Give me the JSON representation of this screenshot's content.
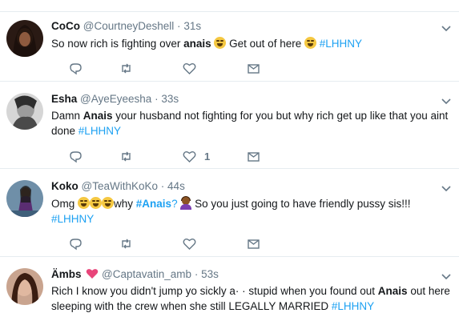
{
  "tweets": [
    {
      "name": "CoCo",
      "handle": "@CourtneyDeshell",
      "dot": "·",
      "time": "31s",
      "text_a": "So now rich is fighting over ",
      "text_b": "anais",
      "text_c": " Get out of here ",
      "text_d": "#LHHNY",
      "likes": ""
    },
    {
      "name": "Esha",
      "handle": "@AyeEyeesha",
      "dot": "·",
      "time": "33s",
      "text_a": "Damn ",
      "text_b": "Anais",
      "text_c": " your husband not fighting for you but why rich get up like that you aint done ",
      "text_d": "#LHHNY",
      "likes": "1"
    },
    {
      "name": "Koko",
      "handle": "@TeaWithKoKo",
      "dot": "·",
      "time": "44s",
      "text_a": "Omg ",
      "text_b": "why ",
      "text_c": "#Anais",
      "text_d": "?",
      "text_e": " So you just going to have friendly pussy sis!!! ",
      "text_f": "#LHHNY",
      "likes": ""
    },
    {
      "name": "Ämbs",
      "handle": "@Captavatin_amb",
      "dot": "·",
      "time": "53s",
      "text_a": "Rich I know you didn't jump yo sickly a· · stupid when you found out ",
      "text_b": "Anais",
      "text_c": " out here sleeping with the crew when she still LEGALLY MARRIED ",
      "text_d": "#LHHNY",
      "likes": ""
    }
  ],
  "colors": {
    "link": "#1da1f2",
    "muted": "#657786",
    "border": "#e6ecf0"
  },
  "icons": [
    "reply-icon",
    "retweet-icon",
    "like-icon",
    "dm-icon",
    "caret-down-icon"
  ]
}
